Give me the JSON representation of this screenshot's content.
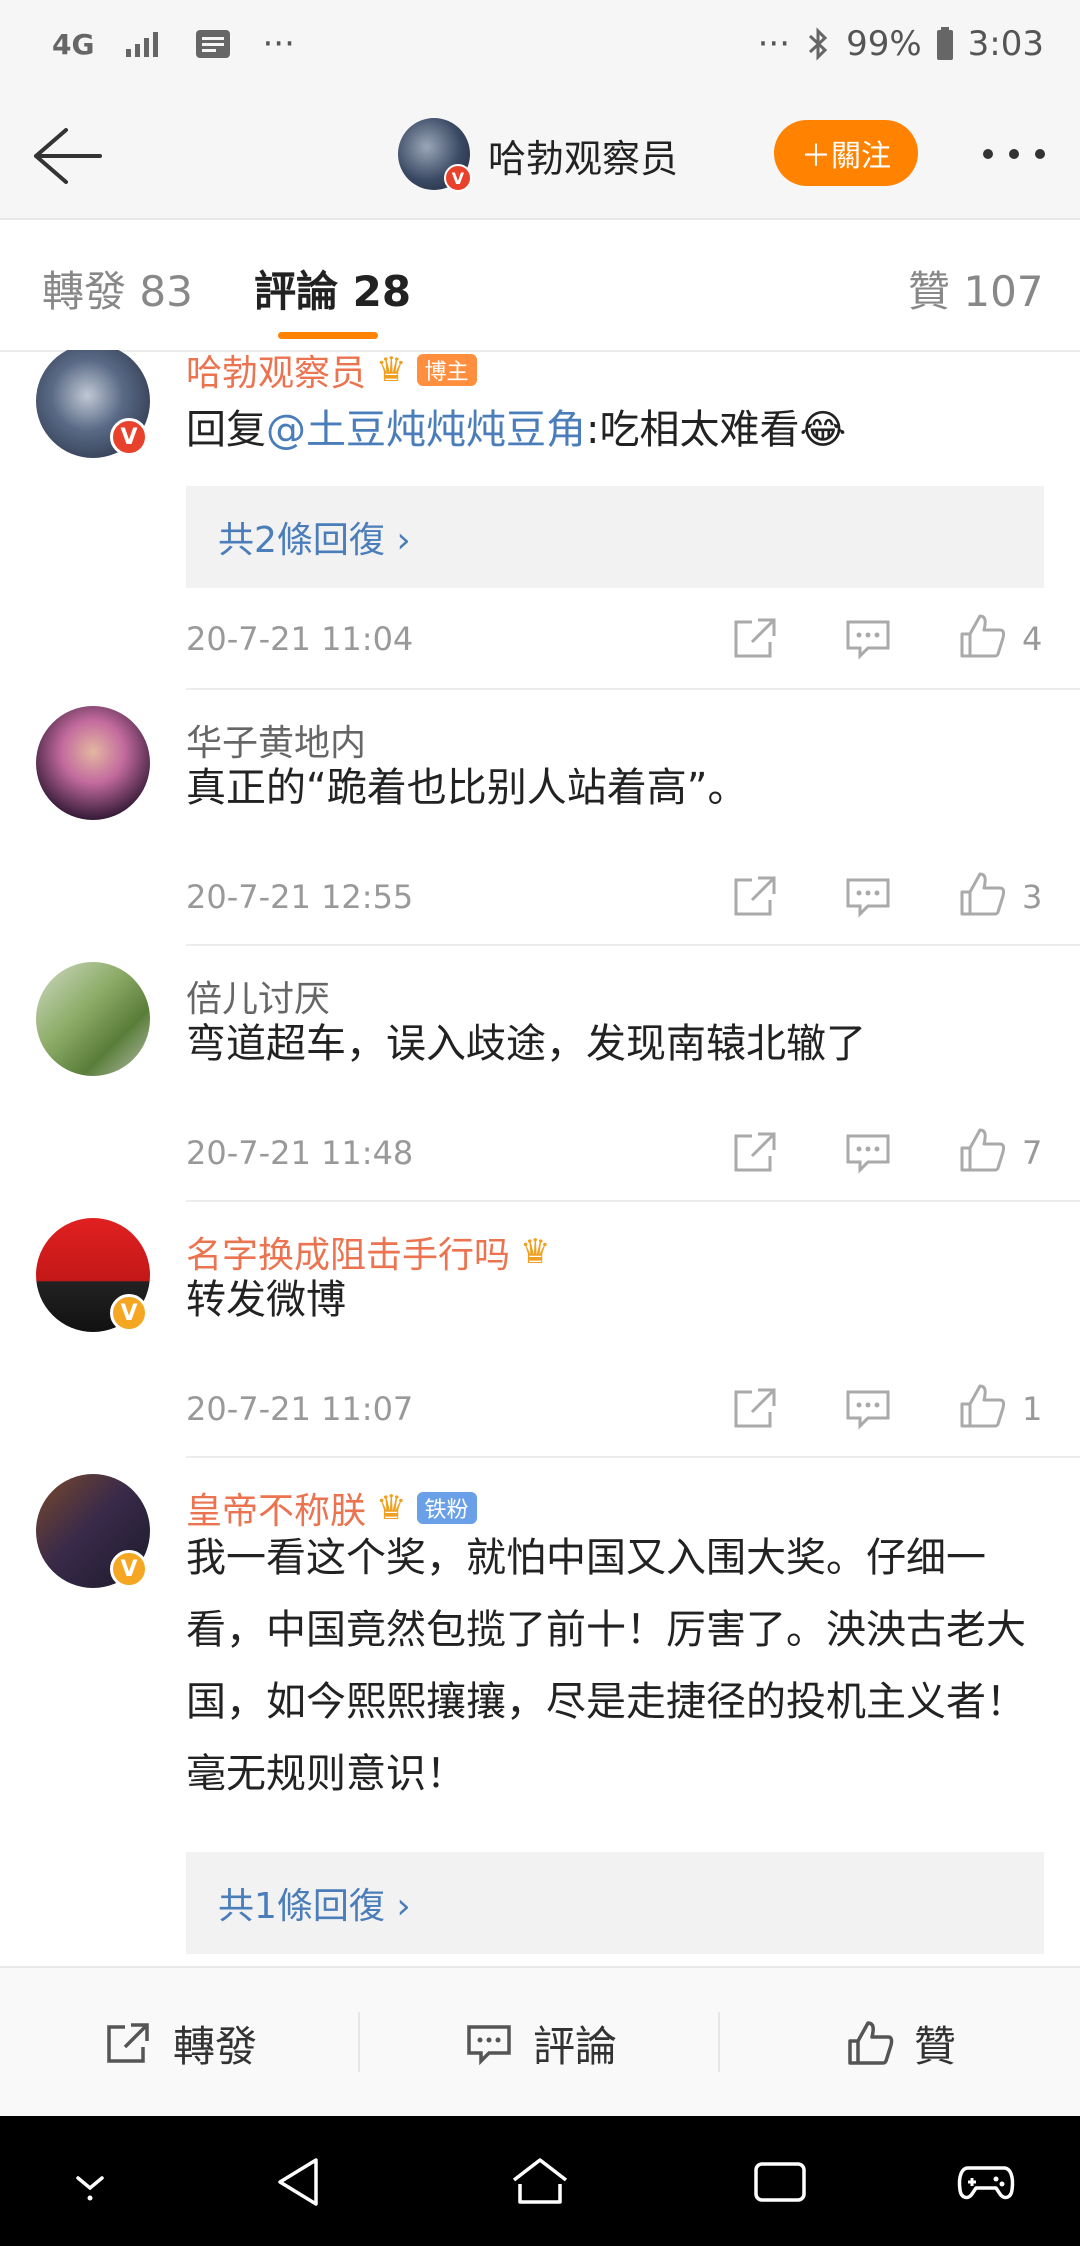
{
  "status_bar": {
    "network": "4G",
    "more": "···",
    "more_right": "···",
    "battery": "99%",
    "time": "3:03"
  },
  "header": {
    "title": "哈勃观察员",
    "follow_label": "＋關注"
  },
  "tabs": [
    {
      "label": "轉發 83"
    },
    {
      "label": "評論 28"
    },
    {
      "label": "贊 107"
    }
  ],
  "comments": [
    {
      "name": "哈勃观察员",
      "badge": "博主",
      "text_prefix": "回复",
      "mention": "@土豆炖炖炖豆角",
      "text": ":吃相太难看😂",
      "reply_summary": "共2條回復 ›",
      "time": "20-7-21 11:04",
      "likes": "4"
    },
    {
      "name": "华子黄地内",
      "text": "真正的“跪着也比别人站着高”。",
      "time": "20-7-21 12:55",
      "likes": "3"
    },
    {
      "name": "倍儿讨厌",
      "text": "弯道超车，误入歧途，发现南辕北辙了",
      "time": "20-7-21 11:48",
      "likes": "7"
    },
    {
      "name": "名字换成阻击手行吗",
      "text": "转发微博",
      "time": "20-7-21 11:07",
      "likes": "1"
    },
    {
      "name": "皇帝不称朕",
      "badge": "铁粉",
      "text": "我一看这个奖，就怕中国又入围大奖。仔细一看，中国竟然包揽了前十！厉害了。泱泱古老大国，如今熙熙攘攘，尽是走捷径的投机主义者！毫无规则意识！",
      "reply_summary": "共1條回復 ›"
    }
  ],
  "bottom_bar": {
    "repost": "轉發",
    "comment": "評論",
    "like": "贊"
  },
  "colors": {
    "accent": "#ff8200",
    "link": "#4a7db9",
    "vip_name": "#eb7350",
    "verified_orange": "#f5a623",
    "verified_red": "#e8412c"
  }
}
